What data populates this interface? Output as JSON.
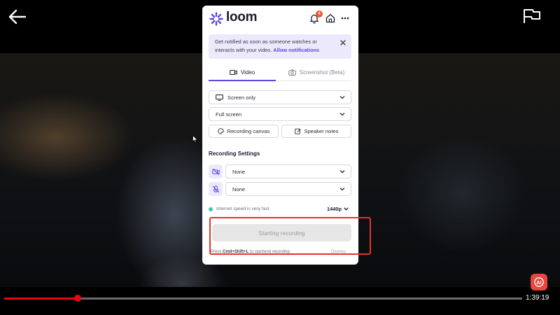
{
  "player": {
    "time_remaining": "1:39:19",
    "progress_fraction": 0.142
  },
  "loom": {
    "logo_text": "loom",
    "notification_count": "4",
    "notice": {
      "text": "Get notified as soon as someone watches or interacts with your video. ",
      "link": "Allow notifications"
    },
    "tabs": [
      {
        "label": "Video",
        "active": true
      },
      {
        "label": "Screenshot (Beta)",
        "active": false
      }
    ],
    "source_select": "Screen only",
    "size_select": "Full screen",
    "recording_canvas_label": "Recording canvas",
    "speaker_notes_label": "Speaker notes",
    "settings_title": "Recording Settings",
    "camera_select": "None",
    "microphone_select": "None",
    "internet_status": "Internet speed is very fast.",
    "quality": "1440p",
    "start_button": "Starting recording",
    "shortcut_prefix": "Press ",
    "shortcut_keys": "Cmd+Shift+L",
    "shortcut_suffix": " to start/end recording",
    "dismiss_label": "Dismiss"
  },
  "colors": {
    "accent": "#5b47e0",
    "seek": "#e50914",
    "highlight": "#e0332e"
  }
}
